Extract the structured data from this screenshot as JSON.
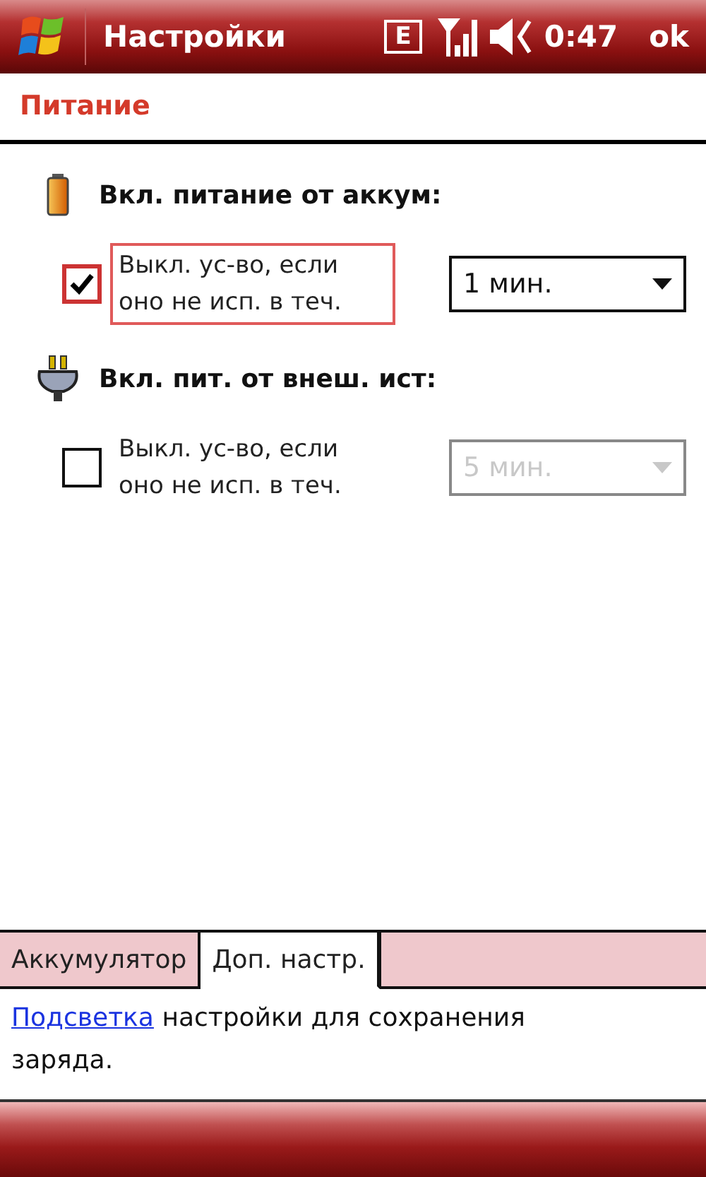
{
  "title_bar": {
    "title": "Настройки",
    "network": "E",
    "time": "0:47",
    "ok": "ok"
  },
  "page_title": "Питание",
  "sections": [
    {
      "kind": "battery",
      "heading": "Вкл. питание от аккум:",
      "option": {
        "label": "Выкл. ус-во, если оно не исп. в теч.",
        "checked": true,
        "focused": true
      },
      "timeout": {
        "value": "1 мин.",
        "disabled": false
      }
    },
    {
      "kind": "plug",
      "heading": "Вкл. пит. от внеш. ист:",
      "option": {
        "label": "Выкл. ус-во, если оно не исп. в теч.",
        "checked": false,
        "focused": false
      },
      "timeout": {
        "value": "5 мин.",
        "disabled": true
      }
    }
  ],
  "tabs": [
    {
      "label": "Аккумулятор",
      "selected": false
    },
    {
      "label": "Доп. настр.",
      "selected": true
    }
  ],
  "footer": {
    "link": "Подсветка",
    "text": "настройки для сохранения заряда."
  }
}
